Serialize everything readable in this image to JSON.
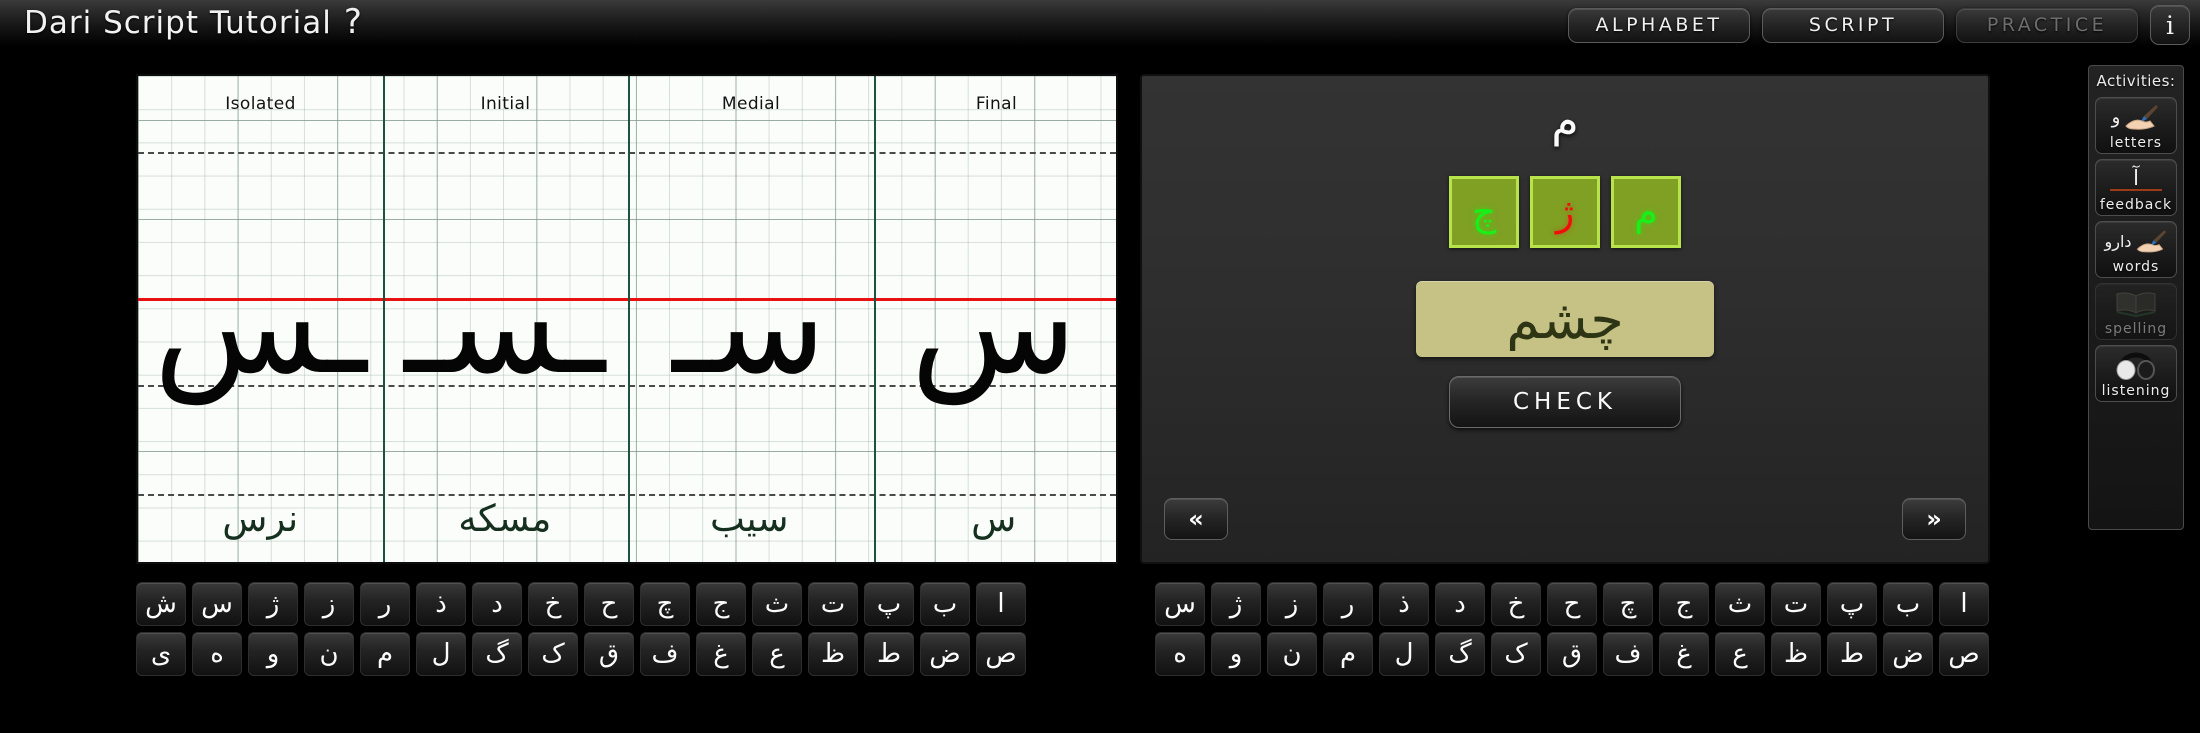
{
  "header": {
    "title": "Dari Script Tutorial",
    "title_glyph": "؟",
    "nav": [
      {
        "label": "ALPHABET",
        "state": "active"
      },
      {
        "label": "SCRIPT",
        "state": "active"
      },
      {
        "label": "PRACTICE",
        "state": "disabled"
      }
    ],
    "info_label": "i"
  },
  "script_grid": {
    "columns": [
      {
        "header": "Final",
        "glyph": "ـس",
        "word": "نرس"
      },
      {
        "header": "Medial",
        "glyph": "ـسـ",
        "word": "مسکه"
      },
      {
        "header": "Initial",
        "glyph": "سـ",
        "word": "سیب"
      },
      {
        "header": "Isolated",
        "glyph": "س",
        "word": "س"
      }
    ],
    "baseline_color": "#e81111",
    "divider_color": "#1c5340"
  },
  "practice": {
    "prompt_letter": "م",
    "tiles": [
      {
        "letter": "م",
        "state": "correct"
      },
      {
        "letter": "ژ",
        "state": "wrong"
      },
      {
        "letter": "چ",
        "state": "correct"
      }
    ],
    "word": "چشم",
    "check_label": "CHECK",
    "prev_label": "«",
    "next_label": "»",
    "tile_bg": "#7fa023",
    "tile_border": "#b9e34a",
    "word_card_bg": "#c6c285",
    "word_card_fg": "#2d3514",
    "correct_color": "#18f018",
    "wrong_color": "#f20d0d"
  },
  "activities": {
    "header": "Activities:",
    "items": [
      {
        "label": "letters",
        "icon": "brush-writing-letter-icon",
        "glyph": "و",
        "state": "enabled"
      },
      {
        "label": "feedback",
        "icon": "underlined-alef-icon",
        "glyph": "آ",
        "state": "enabled"
      },
      {
        "label": "words",
        "icon": "brush-writing-word-icon",
        "glyph": "دارو",
        "state": "enabled"
      },
      {
        "label": "spelling",
        "icon": "open-book-icon",
        "glyph": "",
        "state": "disabled"
      },
      {
        "label": "listening",
        "icon": "headphones-icon",
        "glyph": "",
        "state": "enabled"
      }
    ]
  },
  "keyboard_left": {
    "row1": [
      "ا",
      "ب",
      "پ",
      "ت",
      "ث",
      "ج",
      "چ",
      "ح",
      "خ",
      "د",
      "ذ",
      "ر",
      "ز",
      "ژ",
      "س",
      "ش"
    ],
    "row2": [
      "ص",
      "ض",
      "ط",
      "ظ",
      "ع",
      "غ",
      "ف",
      "ق",
      "ک",
      "گ",
      "ل",
      "م",
      "ن",
      "و",
      "ه",
      "ی"
    ]
  },
  "keyboard_right": {
    "row1": [
      "ا",
      "ب",
      "پ",
      "ت",
      "ث",
      "ج",
      "چ",
      "ح",
      "خ",
      "د",
      "ذ",
      "ر",
      "ز",
      "ژ",
      "س"
    ],
    "row2": [
      "ص",
      "ض",
      "ط",
      "ظ",
      "ع",
      "غ",
      "ف",
      "ق",
      "ک",
      "گ",
      "ل",
      "م",
      "ن",
      "و",
      "ه"
    ]
  }
}
